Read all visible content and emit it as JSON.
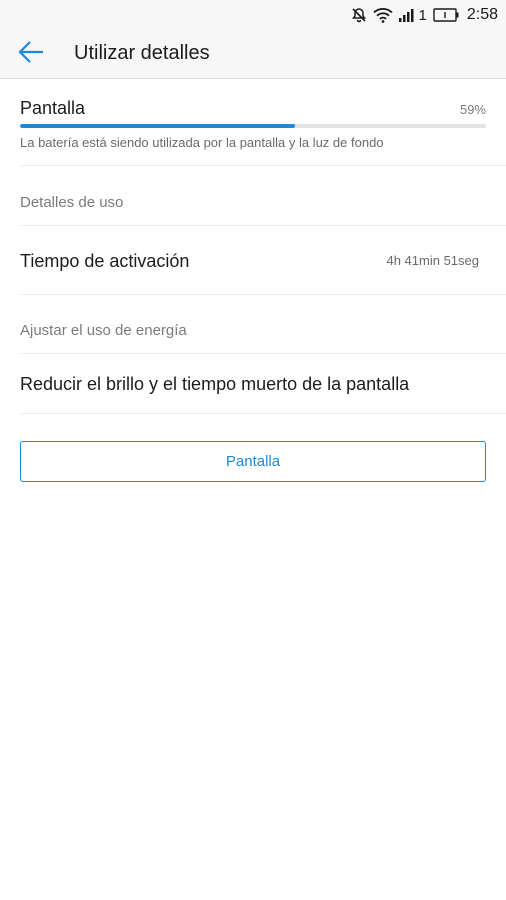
{
  "status_bar": {
    "sim_number": "1",
    "time": "2:58",
    "icons": [
      "mute-icon",
      "wifi-icon",
      "signal-icon",
      "battery-icon"
    ]
  },
  "app_bar": {
    "back_icon": "back-arrow-icon",
    "title": "Utilizar detalles"
  },
  "usage": {
    "name": "Pantalla",
    "percent_label": "59%",
    "percent_value": 59,
    "description": "La batería está siendo utilizada por la pantalla y la luz de fondo"
  },
  "details": {
    "header": "Detalles de uso",
    "rows": [
      {
        "label": "Tiempo de activación",
        "value": "4h 41min 51seg"
      }
    ]
  },
  "energy": {
    "header": "Ajustar el uso de energía",
    "rows": [
      {
        "label": "Reducir el brillo y el tiempo muerto de la pantalla"
      }
    ]
  },
  "action_button": {
    "label": "Pantalla"
  },
  "colors": {
    "accent": "#1e88d8",
    "progress_track": "#e3e3e3",
    "header_bg": "#f7f7f7"
  }
}
